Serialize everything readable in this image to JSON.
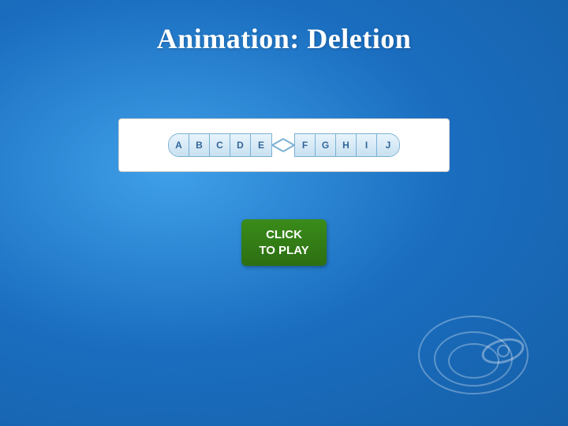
{
  "title": "Animation: Deletion",
  "chromosome": {
    "left_segments": [
      "A",
      "B",
      "C",
      "D",
      "E"
    ],
    "right_segments": [
      "F",
      "G",
      "H",
      "I",
      "J"
    ]
  },
  "play_button": {
    "line1": "CLICK",
    "line2": "TO PLAY",
    "label": "CLICK\nTO PLAY"
  },
  "colors": {
    "background_start": "#3fa0e8",
    "background_end": "#1560a8",
    "segment_bg": "#c8e0f0",
    "segment_border": "#7ab0d4",
    "segment_text": "#336699",
    "button_bg": "#2d6e12",
    "title_color": "#ffffff"
  }
}
